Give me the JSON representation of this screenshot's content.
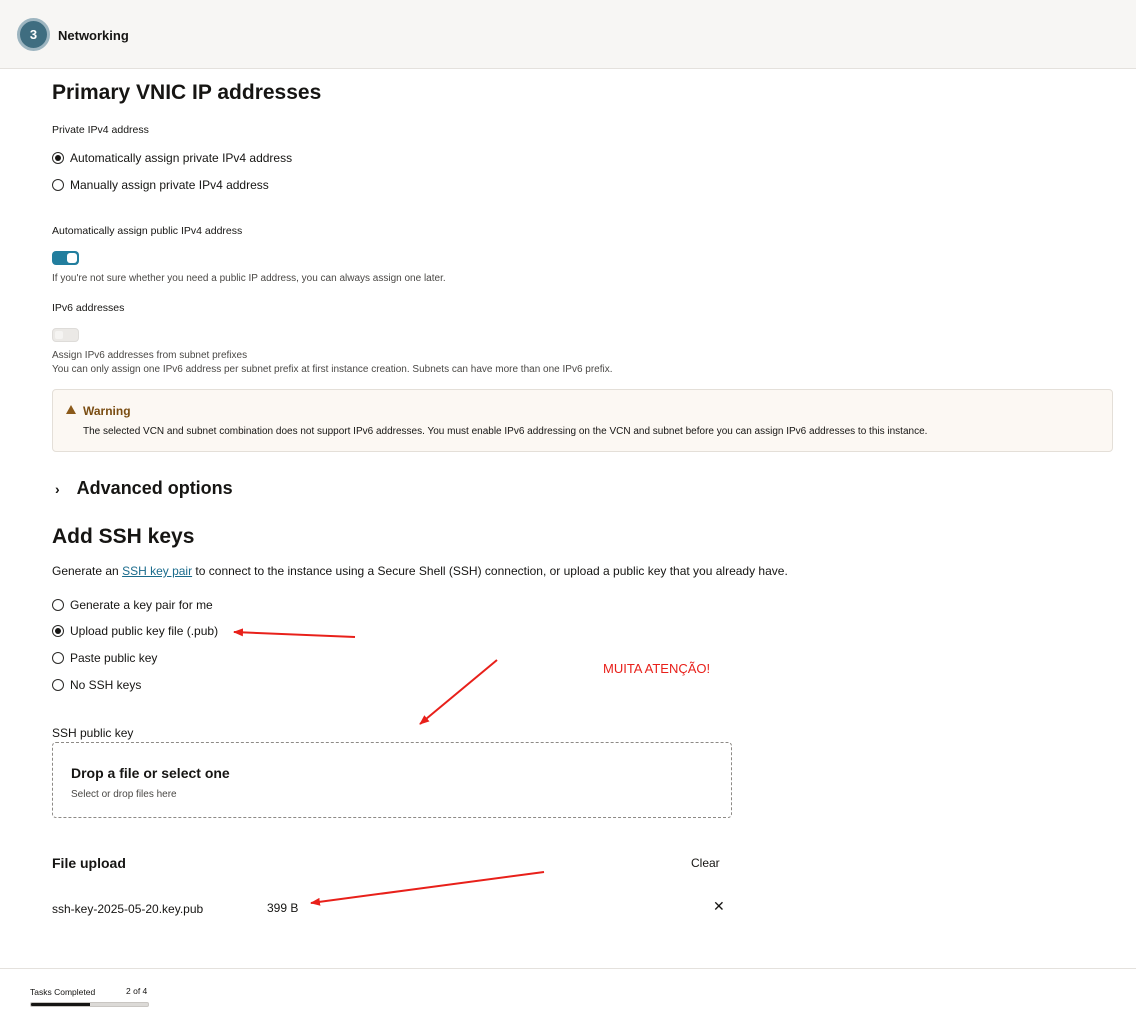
{
  "header": {
    "step_number": "3",
    "step_title": "Networking"
  },
  "vnic": {
    "title": "Primary VNIC IP addresses",
    "private_label": "Private IPv4 address",
    "radio_auto": "Automatically assign private IPv4 address",
    "radio_manual": "Manually assign private IPv4 address",
    "radio_auto_checked": true,
    "public_label": "Automatically assign public IPv4 address",
    "public_toggle_on": true,
    "public_help": "If you're not sure whether you need a public IP address, you can always assign one later.",
    "ipv6_label": "IPv6 addresses",
    "ipv6_toggle_on": false,
    "ipv6_help_1": "Assign IPv6 addresses from subnet prefixes",
    "ipv6_help_2": "You can only assign one IPv6 address per subnet prefix at first instance creation. Subnets can have more than one IPv6 prefix."
  },
  "warning": {
    "title": "Warning",
    "text": "The selected VCN and subnet combination does not support IPv6 addresses. You must enable IPv6 addressing on the VCN and subnet before you can assign IPv6 addresses to this instance."
  },
  "advanced": {
    "label": "Advanced options"
  },
  "ssh": {
    "title": "Add SSH keys",
    "desc_prefix": "Generate an ",
    "desc_link": "SSH key pair",
    "desc_suffix": " to connect to the instance using a Secure Shell (SSH) connection, or upload a public key that you already have.",
    "options": [
      "Generate a key pair for me",
      "Upload public key file (.pub)",
      "Paste public key",
      "No SSH keys"
    ],
    "selected_index": 1,
    "field_label": "SSH public key",
    "dropzone_title": "Drop a file or select one",
    "dropzone_sub": "Select or drop files here"
  },
  "file_upload": {
    "title": "File upload",
    "clear_label": "Clear",
    "file_name": "ssh-key-2025-05-20.key.pub",
    "file_size": "399 B",
    "remove_glyph": "✕"
  },
  "annotation": {
    "text": "MUITA ATENÇÃO!",
    "color": "#e8201a"
  },
  "footer": {
    "tasks_label": "Tasks Completed",
    "tasks_count": "2 of 4",
    "progress": 0.5
  }
}
